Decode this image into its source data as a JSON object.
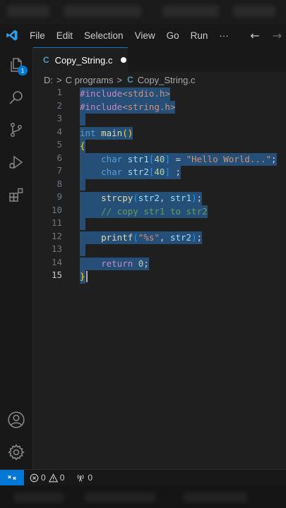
{
  "menu": {
    "items": [
      "File",
      "Edit",
      "Selection",
      "View",
      "Go",
      "Run",
      "···"
    ],
    "back_arrow": "←",
    "forward_arrow": "→"
  },
  "activity_bar": {
    "explorer_badge": "1",
    "icons": [
      "files-icon",
      "search-icon",
      "source-control-icon",
      "run-debug-icon",
      "extensions-icon",
      "account-icon",
      "settings-gear-icon"
    ]
  },
  "tab": {
    "icon_glyph": "C",
    "filename": "Copy_String.c",
    "modified": true
  },
  "breadcrumb": {
    "drive": "D:",
    "folder": "C programs",
    "icon_glyph": "C",
    "file": "Copy_String.c",
    "sep": ">"
  },
  "editor": {
    "current_line": 15,
    "line_numbers": [
      "1",
      "2",
      "3",
      "4",
      "5",
      "6",
      "7",
      "8",
      "9",
      "10",
      "11",
      "12",
      "13",
      "14",
      "15"
    ],
    "lines": [
      [
        {
          "t": "#include",
          "c": "pp"
        },
        {
          "t": "<stdio.h>",
          "c": "s"
        }
      ],
      [
        {
          "t": "#include",
          "c": "pp"
        },
        {
          "t": "<string.h>",
          "c": "s"
        }
      ],
      [
        {
          "t": "",
          "c": "p"
        }
      ],
      [
        {
          "t": "int",
          "c": "t"
        },
        {
          "t": " ",
          "c": "p"
        },
        {
          "t": "main",
          "c": "f"
        },
        {
          "t": "()",
          "c": "gold"
        }
      ],
      [
        {
          "t": "{",
          "c": "gold"
        }
      ],
      [
        {
          "t": "    ",
          "c": "p"
        },
        {
          "t": "char",
          "c": "t"
        },
        {
          "t": " ",
          "c": "p"
        },
        {
          "t": "str1",
          "c": "v"
        },
        {
          "t": "[",
          "c": "ltblue"
        },
        {
          "t": "40",
          "c": "n"
        },
        {
          "t": "]",
          "c": "ltblue"
        },
        {
          "t": " = ",
          "c": "p"
        },
        {
          "t": "\"Hello World...\"",
          "c": "s"
        },
        {
          "t": ";",
          "c": "p"
        }
      ],
      [
        {
          "t": "    ",
          "c": "p"
        },
        {
          "t": "char",
          "c": "t"
        },
        {
          "t": " ",
          "c": "p"
        },
        {
          "t": "str2",
          "c": "v"
        },
        {
          "t": "[",
          "c": "ltblue"
        },
        {
          "t": "40",
          "c": "n"
        },
        {
          "t": "]",
          "c": "ltblue"
        },
        {
          "t": " ;",
          "c": "p"
        }
      ],
      [
        {
          "t": "",
          "c": "p"
        }
      ],
      [
        {
          "t": "    ",
          "c": "p"
        },
        {
          "t": "strcpy",
          "c": "f"
        },
        {
          "t": "(",
          "c": "ltblue"
        },
        {
          "t": "str2",
          "c": "v"
        },
        {
          "t": ", ",
          "c": "p"
        },
        {
          "t": "str1",
          "c": "v"
        },
        {
          "t": ")",
          "c": "ltblue"
        },
        {
          "t": ";",
          "c": "p"
        }
      ],
      [
        {
          "t": "    ",
          "c": "p"
        },
        {
          "t": "// copy str1 to str2",
          "c": "c"
        }
      ],
      [
        {
          "t": "",
          "c": "p"
        }
      ],
      [
        {
          "t": "    ",
          "c": "p"
        },
        {
          "t": "printf",
          "c": "f"
        },
        {
          "t": "(",
          "c": "ltblue"
        },
        {
          "t": "\"%s\"",
          "c": "s"
        },
        {
          "t": ", ",
          "c": "p"
        },
        {
          "t": "str2",
          "c": "v"
        },
        {
          "t": ")",
          "c": "ltblue"
        },
        {
          "t": ";",
          "c": "p"
        }
      ],
      [
        {
          "t": "",
          "c": "p"
        }
      ],
      [
        {
          "t": "    ",
          "c": "p"
        },
        {
          "t": "return",
          "c": "r"
        },
        {
          "t": " ",
          "c": "p"
        },
        {
          "t": "0",
          "c": "n"
        },
        {
          "t": ";",
          "c": "p"
        }
      ],
      [
        {
          "t": "}",
          "c": "gold"
        }
      ]
    ]
  },
  "status": {
    "remote_glyph": "⨯",
    "errors": "0",
    "warnings": "0",
    "ports": "0"
  },
  "colors": {
    "accent": "#0078d4",
    "selection": "#264f78",
    "background": "#1f1f1f"
  }
}
